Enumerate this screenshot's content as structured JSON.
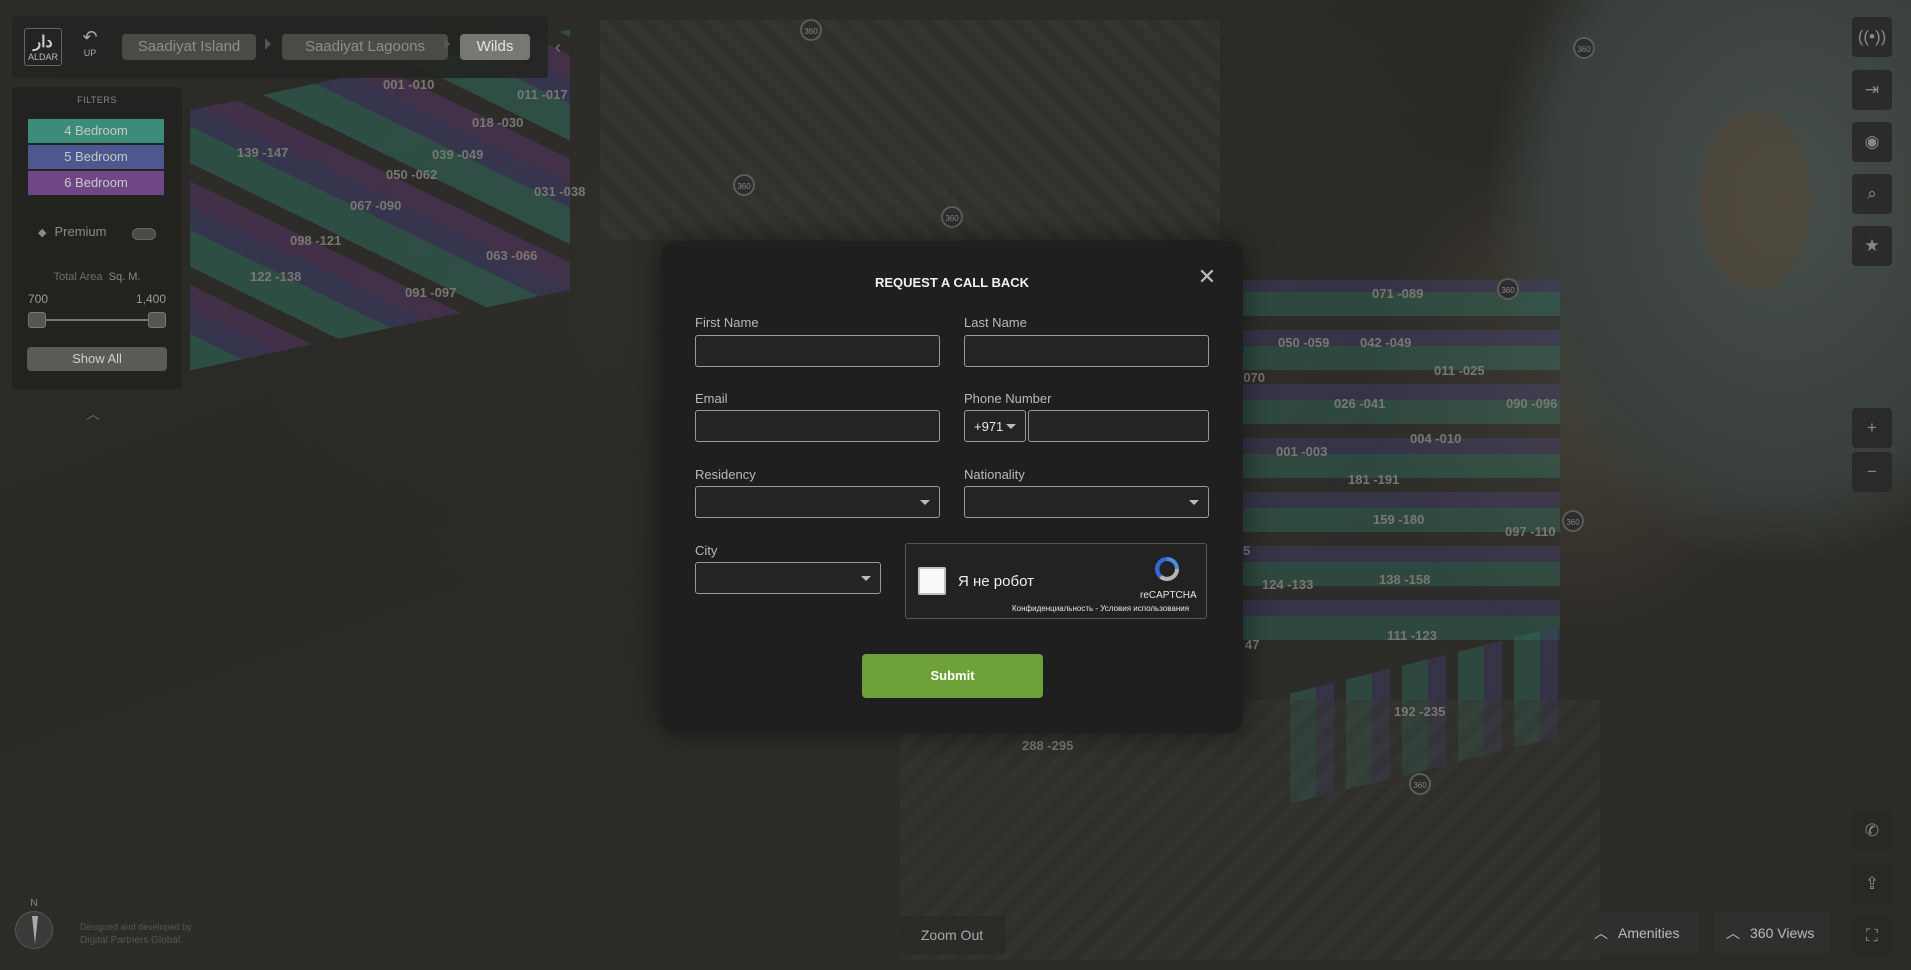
{
  "breadcrumb": {
    "up_label": "UP",
    "logo_text": "ALDAR",
    "items": [
      {
        "label": "Saadiyat Island"
      },
      {
        "label": "Saadiyat Lagoons"
      },
      {
        "label": "Wilds"
      }
    ]
  },
  "filters": {
    "title": "FILTERS",
    "bedrooms": [
      {
        "label": "4 Bedroom",
        "color": "#3fa88f"
      },
      {
        "label": "5 Bedroom",
        "color": "#5a66a6"
      },
      {
        "label": "6 Bedroom",
        "color": "#8a56a0"
      }
    ],
    "premium_label": "Premium",
    "total_area_label": "Total Area",
    "total_area_unit": "Sq. M.",
    "area_min": "700",
    "area_max": "1,400",
    "show_all_label": "Show All"
  },
  "map": {
    "plot_labels": [
      "001 -010",
      "011 -017",
      "018 -030",
      "139 -147",
      "039 -049",
      "050 -062",
      "031 -038",
      "067 -090",
      "098 -121",
      "063 -066",
      "122 -138",
      "091 -097",
      "071 -089",
      "050 -059",
      "042 -049",
      "011 -025",
      "-070",
      "026 -041",
      "090 -096",
      "004 -010",
      "001 -003",
      "181 -191",
      "159 -180",
      "097 -110",
      "5",
      "124 -133",
      "138 -158",
      "111 -123",
      "47",
      "192 -235",
      "288 -295"
    ]
  },
  "modal": {
    "title": "REQUEST A CALL BACK",
    "first_name_label": "First Name",
    "last_name_label": "Last Name",
    "email_label": "Email",
    "phone_label": "Phone Number",
    "phone_code": "+971",
    "residency_label": "Residency",
    "nationality_label": "Nationality",
    "city_label": "City",
    "captcha_checkbox_text": "Я не робот",
    "captcha_brand": "reCAPTCHA",
    "captcha_links": "Конфиденциальность - Условия использования",
    "submit_label": "Submit"
  },
  "bottom": {
    "zoom_out_label": "Zoom Out",
    "amenities_label": "Amenities",
    "views_label": "360 Views",
    "compass_north": "N",
    "credit_line1": "Designed and developed by",
    "credit_line2": "Digital Partners Global"
  },
  "colors": {
    "submit": "#6fa13a",
    "modal_bg": "#1f1f1f",
    "four_bed": "#3fa88f",
    "five_bed": "#5a66a6",
    "six_bed": "#8a56a0"
  }
}
